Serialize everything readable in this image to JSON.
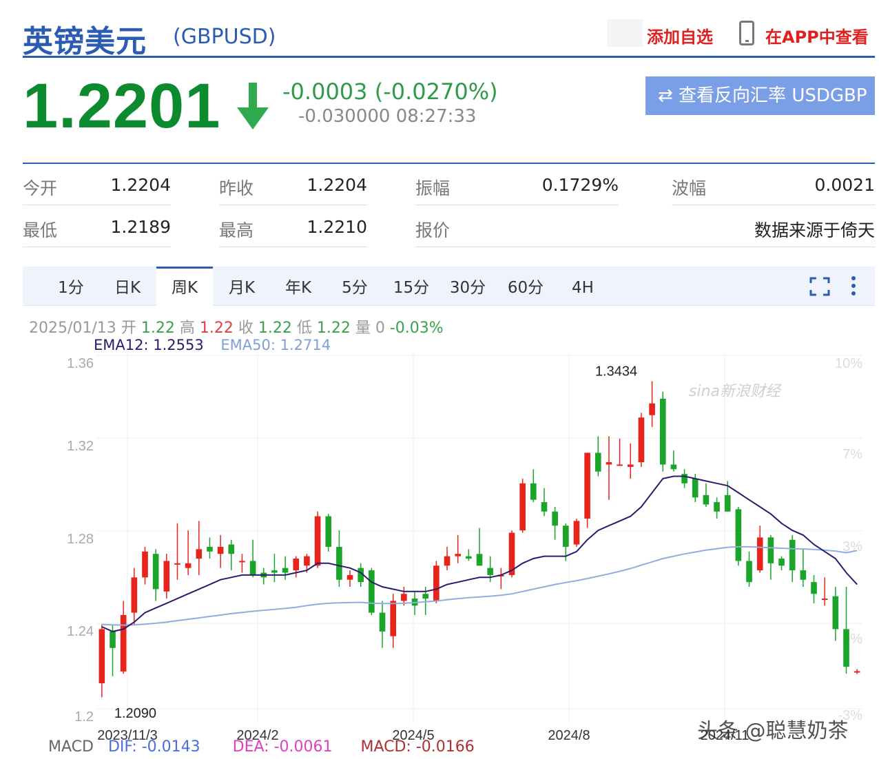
{
  "header": {
    "title": "英镑美元",
    "symbol": "(GBPUSD)",
    "add_watch": "添加自选",
    "app_link": "在APP中查看"
  },
  "quote": {
    "price": "1.2201",
    "change": "-0.0003 (-0.0270%)",
    "sub": "-0.030000 08:27:33",
    "reverse_button": "⇄ 查看反向汇率 USDGBP",
    "colors": {
      "down": "#0b8a2e",
      "accent": "#2c5bb3"
    }
  },
  "stats": {
    "open_label": "今开",
    "open": "1.2204",
    "prev_close_label": "昨收",
    "prev_close": "1.2204",
    "amplitude_label": "振幅",
    "amplitude": "0.1729%",
    "wave_label": "波幅",
    "wave": "0.0021",
    "low_label": "最低",
    "low": "1.2189",
    "high_label": "最高",
    "high": "1.2210",
    "quote_label": "报价",
    "source": "数据来源于倚天"
  },
  "tabs": [
    {
      "label": "1分"
    },
    {
      "label": "日K"
    },
    {
      "label": "周K"
    },
    {
      "label": "月K"
    },
    {
      "label": "年K"
    },
    {
      "label": "5分"
    },
    {
      "label": "15分"
    },
    {
      "label": "30分"
    },
    {
      "label": "60分"
    },
    {
      "label": "4H"
    }
  ],
  "active_tab": "周K",
  "bar_info": {
    "date": "2025/01/13",
    "open_label": "开",
    "open": "1.22",
    "high_label": "高",
    "high": "1.22",
    "close_label": "收",
    "close": "1.22",
    "low_label": "低",
    "low": "1.22",
    "vol_label": "量",
    "vol": "0",
    "pct": "-0.03%"
  },
  "ema": {
    "ema12": "EMA12: 1.2553",
    "ema50": "EMA50: 1.2714"
  },
  "macd": {
    "label": "MACD",
    "dif": "DIF: -0.0143",
    "dea": "DEA: -0.0061",
    "macd": "MACD: -0.0166"
  },
  "watermarks": {
    "sina": "sina新浪财经",
    "toutiao": "头条 @聪慧奶茶"
  },
  "chart_data": {
    "type": "candlestick",
    "y_ticks": [
      "1.36",
      "1.32",
      "1.28",
      "1.24",
      "1.2"
    ],
    "y_right_ticks": [
      "10%",
      "7%",
      "3%",
      "0%",
      "-3%"
    ],
    "ylim": [
      1.2,
      1.36
    ],
    "x_ticks": [
      {
        "label": "2023/11/3",
        "index": 1
      },
      {
        "label": "2024/2",
        "index": 14
      },
      {
        "label": "2024/5",
        "index": 27
      },
      {
        "label": "2024/8",
        "index": 40
      },
      {
        "label": "2024/11",
        "index": 53
      }
    ],
    "annotations": [
      {
        "text": "1.2090",
        "index": 0,
        "value": 1.209
      },
      {
        "text": "1.3434",
        "index": 47,
        "value": 1.3434
      }
    ],
    "colors": {
      "up": "#e8231b",
      "down": "#1aa52a",
      "ema12": "#2a1b6e",
      "ema50": "#8fadde",
      "grid": "#eeeeee"
    },
    "candles": [
      {
        "o": 1.215,
        "h": 1.24,
        "l": 1.209,
        "c": 1.238
      },
      {
        "o": 1.237,
        "h": 1.24,
        "l": 1.218,
        "c": 1.23
      },
      {
        "o": 1.22,
        "h": 1.25,
        "l": 1.219,
        "c": 1.244
      },
      {
        "o": 1.245,
        "h": 1.264,
        "l": 1.24,
        "c": 1.26
      },
      {
        "o": 1.26,
        "h": 1.273,
        "l": 1.257,
        "c": 1.271
      },
      {
        "o": 1.27,
        "h": 1.272,
        "l": 1.25,
        "c": 1.255
      },
      {
        "o": 1.254,
        "h": 1.27,
        "l": 1.251,
        "c": 1.267
      },
      {
        "o": 1.266,
        "h": 1.283,
        "l": 1.259,
        "c": 1.266
      },
      {
        "o": 1.264,
        "h": 1.28,
        "l": 1.261,
        "c": 1.266
      },
      {
        "o": 1.268,
        "h": 1.284,
        "l": 1.261,
        "c": 1.272
      },
      {
        "o": 1.273,
        "h": 1.277,
        "l": 1.268,
        "c": 1.271
      },
      {
        "o": 1.27,
        "h": 1.278,
        "l": 1.264,
        "c": 1.273
      },
      {
        "o": 1.274,
        "h": 1.276,
        "l": 1.263,
        "c": 1.27
      },
      {
        "o": 1.267,
        "h": 1.27,
        "l": 1.262,
        "c": 1.267
      },
      {
        "o": 1.267,
        "h": 1.276,
        "l": 1.26,
        "c": 1.261
      },
      {
        "o": 1.262,
        "h": 1.264,
        "l": 1.257,
        "c": 1.26
      },
      {
        "o": 1.263,
        "h": 1.27,
        "l": 1.258,
        "c": 1.262
      },
      {
        "o": 1.264,
        "h": 1.269,
        "l": 1.259,
        "c": 1.262
      },
      {
        "o": 1.263,
        "h": 1.269,
        "l": 1.26,
        "c": 1.268
      },
      {
        "o": 1.265,
        "h": 1.27,
        "l": 1.262,
        "c": 1.269
      },
      {
        "o": 1.265,
        "h": 1.288,
        "l": 1.264,
        "c": 1.286
      },
      {
        "o": 1.286,
        "h": 1.287,
        "l": 1.271,
        "c": 1.273
      },
      {
        "o": 1.273,
        "h": 1.28,
        "l": 1.256,
        "c": 1.259
      },
      {
        "o": 1.259,
        "h": 1.263,
        "l": 1.256,
        "c": 1.261
      },
      {
        "o": 1.264,
        "h": 1.266,
        "l": 1.256,
        "c": 1.258
      },
      {
        "o": 1.263,
        "h": 1.264,
        "l": 1.244,
        "c": 1.245
      },
      {
        "o": 1.245,
        "h": 1.25,
        "l": 1.23,
        "c": 1.237
      },
      {
        "o": 1.235,
        "h": 1.253,
        "l": 1.23,
        "c": 1.25
      },
      {
        "o": 1.25,
        "h": 1.256,
        "l": 1.248,
        "c": 1.253
      },
      {
        "o": 1.251,
        "h": 1.254,
        "l": 1.244,
        "c": 1.248
      },
      {
        "o": 1.253,
        "h": 1.256,
        "l": 1.244,
        "c": 1.251
      },
      {
        "o": 1.25,
        "h": 1.267,
        "l": 1.249,
        "c": 1.265
      },
      {
        "o": 1.265,
        "h": 1.273,
        "l": 1.263,
        "c": 1.269
      },
      {
        "o": 1.269,
        "h": 1.278,
        "l": 1.266,
        "c": 1.27
      },
      {
        "o": 1.269,
        "h": 1.272,
        "l": 1.267,
        "c": 1.268
      },
      {
        "o": 1.27,
        "h": 1.281,
        "l": 1.265,
        "c": 1.265
      },
      {
        "o": 1.264,
        "h": 1.269,
        "l": 1.258,
        "c": 1.261
      },
      {
        "o": 1.261,
        "h": 1.264,
        "l": 1.255,
        "c": 1.261
      },
      {
        "o": 1.261,
        "h": 1.28,
        "l": 1.26,
        "c": 1.279
      },
      {
        "o": 1.28,
        "h": 1.302,
        "l": 1.279,
        "c": 1.3
      },
      {
        "o": 1.3,
        "h": 1.306,
        "l": 1.292,
        "c": 1.293
      },
      {
        "o": 1.292,
        "h": 1.298,
        "l": 1.286,
        "c": 1.288
      },
      {
        "o": 1.288,
        "h": 1.29,
        "l": 1.276,
        "c": 1.282
      },
      {
        "o": 1.282,
        "h": 1.283,
        "l": 1.267,
        "c": 1.273
      },
      {
        "o": 1.274,
        "h": 1.285,
        "l": 1.273,
        "c": 1.284
      },
      {
        "o": 1.285,
        "h": 1.313,
        "l": 1.281,
        "c": 1.313
      },
      {
        "o": 1.313,
        "h": 1.32,
        "l": 1.303,
        "c": 1.305
      },
      {
        "o": 1.308,
        "h": 1.32,
        "l": 1.293,
        "c": 1.309
      },
      {
        "o": 1.308,
        "h": 1.319,
        "l": 1.308,
        "c": 1.308
      },
      {
        "o": 1.307,
        "h": 1.317,
        "l": 1.302,
        "c": 1.308
      },
      {
        "o": 1.309,
        "h": 1.33,
        "l": 1.307,
        "c": 1.328
      },
      {
        "o": 1.329,
        "h": 1.3434,
        "l": 1.324,
        "c": 1.334
      },
      {
        "o": 1.336,
        "h": 1.339,
        "l": 1.305,
        "c": 1.308
      },
      {
        "o": 1.308,
        "h": 1.314,
        "l": 1.305,
        "c": 1.306
      },
      {
        "o": 1.304,
        "h": 1.306,
        "l": 1.298,
        "c": 1.3
      },
      {
        "o": 1.302,
        "h": 1.304,
        "l": 1.292,
        "c": 1.294
      },
      {
        "o": 1.295,
        "h": 1.3,
        "l": 1.29,
        "c": 1.291
      },
      {
        "o": 1.292,
        "h": 1.294,
        "l": 1.285,
        "c": 1.288
      },
      {
        "o": 1.295,
        "h": 1.301,
        "l": 1.288,
        "c": 1.288
      },
      {
        "o": 1.289,
        "h": 1.29,
        "l": 1.265,
        "c": 1.267
      },
      {
        "o": 1.267,
        "h": 1.271,
        "l": 1.256,
        "c": 1.258
      },
      {
        "o": 1.263,
        "h": 1.282,
        "l": 1.262,
        "c": 1.277
      },
      {
        "o": 1.277,
        "h": 1.278,
        "l": 1.259,
        "c": 1.266
      },
      {
        "o": 1.268,
        "h": 1.269,
        "l": 1.263,
        "c": 1.265
      },
      {
        "o": 1.276,
        "h": 1.278,
        "l": 1.258,
        "c": 1.263
      },
      {
        "o": 1.263,
        "h": 1.272,
        "l": 1.256,
        "c": 1.259
      },
      {
        "o": 1.258,
        "h": 1.261,
        "l": 1.249,
        "c": 1.253
      },
      {
        "o": 1.251,
        "h": 1.26,
        "l": 1.248,
        "c": 1.251
      },
      {
        "o": 1.252,
        "h": 1.256,
        "l": 1.233,
        "c": 1.238
      },
      {
        "o": 1.238,
        "h": 1.256,
        "l": 1.219,
        "c": 1.222
      },
      {
        "o": 1.22,
        "h": 1.221,
        "l": 1.2189,
        "c": 1.2201
      }
    ],
    "ema12": [
      1.239,
      1.237,
      1.238,
      1.241,
      1.245,
      1.247,
      1.249,
      1.251,
      1.253,
      1.255,
      1.257,
      1.259,
      1.26,
      1.261,
      1.261,
      1.261,
      1.261,
      1.261,
      1.262,
      1.263,
      1.266,
      1.266,
      1.265,
      1.264,
      1.262,
      1.258,
      1.256,
      1.255,
      1.254,
      1.254,
      1.254,
      1.255,
      1.257,
      1.258,
      1.259,
      1.26,
      1.26,
      1.261,
      1.263,
      1.266,
      1.268,
      1.269,
      1.269,
      1.269,
      1.271,
      1.276,
      1.28,
      1.282,
      1.284,
      1.286,
      1.29,
      1.296,
      1.302,
      1.303,
      1.303,
      1.302,
      1.301,
      1.3,
      1.299,
      1.296,
      1.293,
      1.29,
      1.287,
      1.283,
      1.28,
      1.278,
      1.274,
      1.271,
      1.268,
      1.262,
      1.257
    ],
    "ema50": [
      1.24,
      1.2398,
      1.2397,
      1.2398,
      1.2401,
      1.2405,
      1.241,
      1.2416,
      1.2422,
      1.2428,
      1.2434,
      1.244,
      1.2446,
      1.2451,
      1.2456,
      1.246,
      1.2464,
      1.2468,
      1.2473,
      1.248,
      1.2486,
      1.249,
      1.2492,
      1.2493,
      1.2494,
      1.249,
      1.2489,
      1.2489,
      1.249,
      1.2493,
      1.2496,
      1.25,
      1.2505,
      1.251,
      1.2514,
      1.2517,
      1.252,
      1.2524,
      1.253,
      1.254,
      1.255,
      1.256,
      1.257,
      1.2578,
      1.2586,
      1.2595,
      1.2605,
      1.2615,
      1.2626,
      1.2638,
      1.2652,
      1.2666,
      1.268,
      1.269,
      1.27,
      1.2708,
      1.2716,
      1.2722,
      1.2728,
      1.273,
      1.273,
      1.2728,
      1.2726,
      1.2724,
      1.2722,
      1.2721,
      1.2719,
      1.2716,
      1.2712,
      1.2705,
      1.2714
    ]
  }
}
